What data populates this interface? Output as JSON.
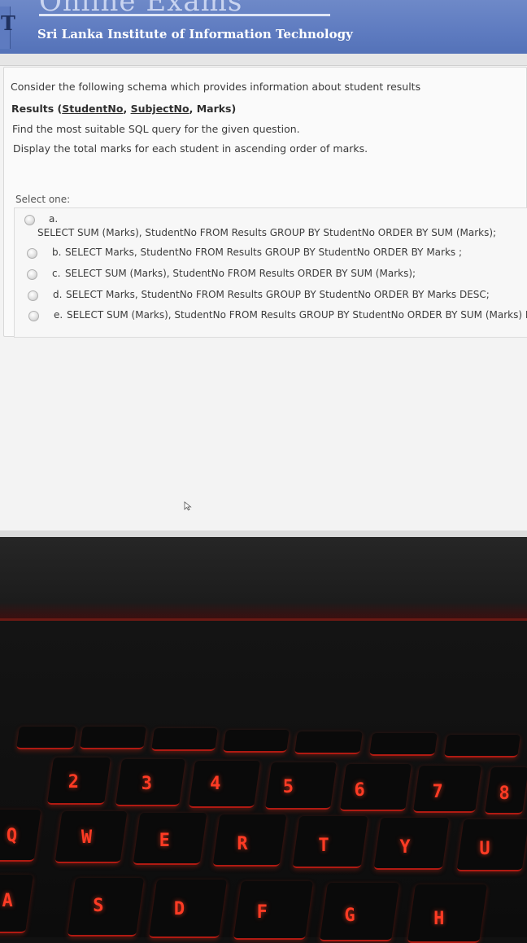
{
  "header": {
    "exam_title": "Online Exams",
    "institute": "Sri Lanka Institute of Information Technology",
    "logo_letter": "T"
  },
  "question": {
    "intro": "Consider the following schema which provides information about student results",
    "schema_prefix": "Results (",
    "schema_field1": "StudentNo",
    "schema_sep1": ", ",
    "schema_field2": "SubjectNo",
    "schema_suffix": ", Marks)",
    "instruction": "Find the most suitable SQL query for the given question.",
    "task": "Display the total marks for each student in ascending order of marks.",
    "select_one": "Select one:",
    "options": [
      {
        "letter": "a.",
        "text": "SELECT SUM (Marks), StudentNo FROM Results GROUP BY StudentNo ORDER BY SUM (Marks);"
      },
      {
        "letter": "b.",
        "text": "SELECT Marks, StudentNo FROM Results GROUP BY StudentNo ORDER BY  Marks ;"
      },
      {
        "letter": "c.",
        "text": "SELECT SUM (Marks), StudentNo FROM Results ORDER BY SUM (Marks);"
      },
      {
        "letter": "d.",
        "text": "SELECT Marks, StudentNo FROM Results GROUP BY StudentNo ORDER BY  Marks DESC;"
      },
      {
        "letter": "e.",
        "text": "SELECT SUM (Marks), StudentNo FROM Results GROUP BY StudentNo ORDER BY SUM (Marks) DESC;"
      }
    ]
  },
  "keyboard": {
    "number_row": [
      "2",
      "3",
      "4",
      "5",
      "6",
      "7",
      "8"
    ],
    "top_row": [
      "Q",
      "W",
      "E",
      "R",
      "T",
      "Y",
      "U"
    ],
    "home_row": [
      "A",
      "S",
      "D",
      "F",
      "G",
      "H"
    ]
  },
  "colors": {
    "header_blue": "#5e7bc0",
    "key_glow": "#ff3b24"
  }
}
